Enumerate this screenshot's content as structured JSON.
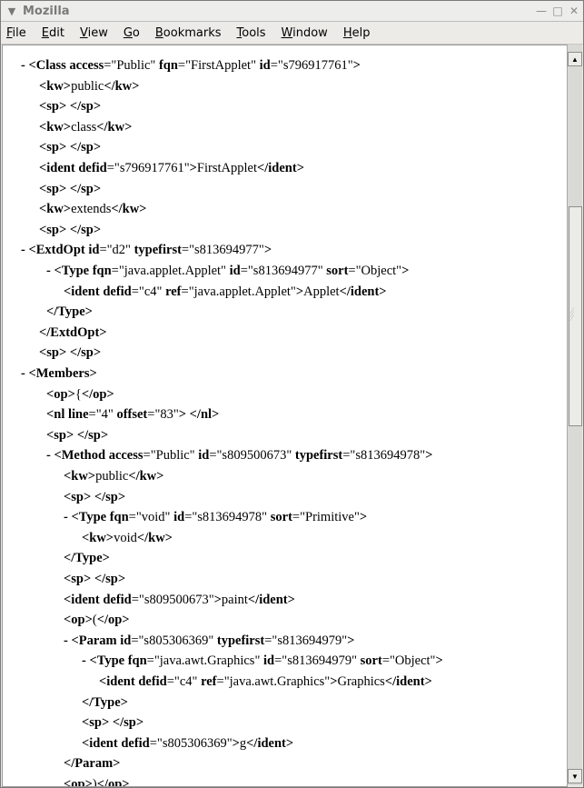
{
  "window": {
    "title": "Mozilla",
    "controls": [
      "minimize",
      "maximize",
      "close"
    ]
  },
  "menu": [
    "File",
    "Edit",
    "View",
    "Go",
    "Bookmarks",
    "Tools",
    "Window",
    "Help"
  ],
  "menu_underline": [
    "F",
    "E",
    "V",
    "G",
    "B",
    "T",
    "W",
    "H"
  ],
  "xml_lines": [
    {
      "t": "- ",
      "parts": [
        [
          "b",
          "<Class "
        ],
        [
          "b",
          "access"
        ],
        [
          "t",
          "=\"Public\" "
        ],
        [
          "b",
          "fqn"
        ],
        [
          "t",
          "=\"FirstApplet\" "
        ],
        [
          "b",
          "id"
        ],
        [
          "t",
          "=\"s796917761\""
        ],
        [
          "b",
          ">"
        ]
      ]
    },
    {
      "parts": [
        [
          "b",
          "<kw>"
        ],
        [
          "t",
          "public"
        ],
        [
          "b",
          "</kw>"
        ]
      ]
    },
    {
      "parts": [
        [
          "b",
          "<sp>"
        ],
        [
          "t",
          " "
        ],
        [
          "b",
          "</sp>"
        ]
      ]
    },
    {
      "parts": [
        [
          "b",
          "<kw>"
        ],
        [
          "t",
          "class"
        ],
        [
          "b",
          "</kw>"
        ]
      ]
    },
    {
      "parts": [
        [
          "b",
          "<sp>"
        ],
        [
          "t",
          " "
        ],
        [
          "b",
          "</sp>"
        ]
      ]
    },
    {
      "parts": [
        [
          "b",
          "<ident "
        ],
        [
          "b",
          "defid"
        ],
        [
          "t",
          "=\"s796917761\""
        ],
        [
          "b",
          ">"
        ],
        [
          "t",
          "FirstApplet"
        ],
        [
          "b",
          "</ident>"
        ]
      ]
    },
    {
      "parts": [
        [
          "b",
          "<sp>"
        ],
        [
          "t",
          " "
        ],
        [
          "b",
          "</sp>"
        ]
      ]
    },
    {
      "parts": [
        [
          "b",
          "<kw>"
        ],
        [
          "t",
          "extends"
        ],
        [
          "b",
          "</kw>"
        ]
      ]
    },
    {
      "parts": [
        [
          "b",
          "<sp>"
        ],
        [
          "t",
          " "
        ],
        [
          "b",
          "</sp>"
        ]
      ]
    },
    {
      "t": "- ",
      "parts": [
        [
          "b",
          "<ExtdOpt "
        ],
        [
          "b",
          "id"
        ],
        [
          "t",
          "=\"d2\" "
        ],
        [
          "b",
          "typefirst"
        ],
        [
          "t",
          "=\"s813694977\""
        ],
        [
          "b",
          ">"
        ]
      ]
    },
    {
      "t": "- ",
      "parts": [
        [
          "b",
          "<Type "
        ],
        [
          "b",
          "fqn"
        ],
        [
          "t",
          "=\"java.applet.Applet\" "
        ],
        [
          "b",
          "id"
        ],
        [
          "t",
          "=\"s813694977\" "
        ],
        [
          "b",
          "sort"
        ],
        [
          "t",
          "=\"Object\""
        ],
        [
          "b",
          ">"
        ]
      ]
    },
    {
      "parts": [
        [
          "b",
          "<ident "
        ],
        [
          "b",
          "defid"
        ],
        [
          "t",
          "=\"c4\" "
        ],
        [
          "b",
          "ref"
        ],
        [
          "t",
          "=\"java.applet.Applet\""
        ],
        [
          "b",
          ">"
        ],
        [
          "t",
          "Applet"
        ],
        [
          "b",
          "</ident>"
        ]
      ]
    },
    {
      "parts": [
        [
          "b",
          "</Type>"
        ]
      ]
    },
    {
      "parts": [
        [
          "b",
          "</ExtdOpt>"
        ]
      ]
    },
    {
      "parts": [
        [
          "b",
          "<sp>"
        ],
        [
          "t",
          " "
        ],
        [
          "b",
          "</sp>"
        ]
      ]
    },
    {
      "t": "- ",
      "parts": [
        [
          "b",
          "<Members>"
        ]
      ]
    },
    {
      "parts": [
        [
          "b",
          "<op>"
        ],
        [
          "t",
          "{"
        ],
        [
          "b",
          "</op>"
        ]
      ]
    },
    {
      "parts": [
        [
          "b",
          "<nl "
        ],
        [
          "b",
          "line"
        ],
        [
          "t",
          "=\"4\" "
        ],
        [
          "b",
          "offset"
        ],
        [
          "t",
          "=\"83\""
        ],
        [
          "b",
          "> </nl>"
        ]
      ]
    },
    {
      "parts": [
        [
          "b",
          "<sp>"
        ],
        [
          "t",
          " "
        ],
        [
          "b",
          "</sp>"
        ]
      ]
    },
    {
      "t": "- ",
      "parts": [
        [
          "b",
          "<Method "
        ],
        [
          "b",
          "access"
        ],
        [
          "t",
          "=\"Public\" "
        ],
        [
          "b",
          "id"
        ],
        [
          "t",
          "=\"s809500673\" "
        ],
        [
          "b",
          "typefirst"
        ],
        [
          "t",
          "=\"s813694978\""
        ],
        [
          "b",
          ">"
        ]
      ]
    },
    {
      "parts": [
        [
          "b",
          "<kw>"
        ],
        [
          "t",
          "public"
        ],
        [
          "b",
          "</kw>"
        ]
      ]
    },
    {
      "parts": [
        [
          "b",
          "<sp>"
        ],
        [
          "t",
          " "
        ],
        [
          "b",
          "</sp>"
        ]
      ]
    },
    {
      "t": "- ",
      "parts": [
        [
          "b",
          "<Type "
        ],
        [
          "b",
          "fqn"
        ],
        [
          "t",
          "=\"void\" "
        ],
        [
          "b",
          "id"
        ],
        [
          "t",
          "=\"s813694978\" "
        ],
        [
          "b",
          "sort"
        ],
        [
          "t",
          "=\"Primitive\""
        ],
        [
          "b",
          ">"
        ]
      ]
    },
    {
      "parts": [
        [
          "b",
          "<kw>"
        ],
        [
          "t",
          "void"
        ],
        [
          "b",
          "</kw>"
        ]
      ]
    },
    {
      "parts": [
        [
          "b",
          "</Type>"
        ]
      ]
    },
    {
      "parts": [
        [
          "b",
          "<sp>"
        ],
        [
          "t",
          " "
        ],
        [
          "b",
          "</sp>"
        ]
      ]
    },
    {
      "parts": [
        [
          "b",
          "<ident "
        ],
        [
          "b",
          "defid"
        ],
        [
          "t",
          "=\"s809500673\""
        ],
        [
          "b",
          ">"
        ],
        [
          "t",
          "paint"
        ],
        [
          "b",
          "</ident>"
        ]
      ]
    },
    {
      "parts": [
        [
          "b",
          "<op>"
        ],
        [
          "t",
          "("
        ],
        [
          "b",
          "</op>"
        ]
      ]
    },
    {
      "t": "- ",
      "parts": [
        [
          "b",
          "<Param "
        ],
        [
          "b",
          "id"
        ],
        [
          "t",
          "=\"s805306369\" "
        ],
        [
          "b",
          "typefirst"
        ],
        [
          "t",
          "=\"s813694979\""
        ],
        [
          "b",
          ">"
        ]
      ]
    },
    {
      "t": "- ",
      "parts": [
        [
          "b",
          "<Type "
        ],
        [
          "b",
          "fqn"
        ],
        [
          "t",
          "=\"java.awt.Graphics\" "
        ],
        [
          "b",
          "id"
        ],
        [
          "t",
          "=\"s813694979\" "
        ],
        [
          "b",
          "sort"
        ],
        [
          "t",
          "=\"Object\""
        ],
        [
          "b",
          ">"
        ]
      ]
    },
    {
      "parts": [
        [
          "b",
          "<ident "
        ],
        [
          "b",
          "defid"
        ],
        [
          "t",
          "=\"c4\" "
        ],
        [
          "b",
          "ref"
        ],
        [
          "t",
          "=\"java.awt.Graphics\""
        ],
        [
          "b",
          ">"
        ],
        [
          "t",
          "Graphics"
        ],
        [
          "b",
          "</ident>"
        ]
      ]
    },
    {
      "parts": [
        [
          "b",
          "</Type>"
        ]
      ]
    },
    {
      "parts": [
        [
          "b",
          "<sp>"
        ],
        [
          "t",
          " "
        ],
        [
          "b",
          "</sp>"
        ]
      ]
    },
    {
      "parts": [
        [
          "b",
          "<ident "
        ],
        [
          "b",
          "defid"
        ],
        [
          "t",
          "=\"s805306369\""
        ],
        [
          "b",
          ">"
        ],
        [
          "t",
          "g"
        ],
        [
          "b",
          "</ident>"
        ]
      ]
    },
    {
      "parts": [
        [
          "b",
          "</Param>"
        ]
      ]
    },
    {
      "parts": [
        [
          "b",
          "<op>"
        ],
        [
          "t",
          ")"
        ],
        [
          "b",
          "</op>"
        ]
      ]
    }
  ]
}
